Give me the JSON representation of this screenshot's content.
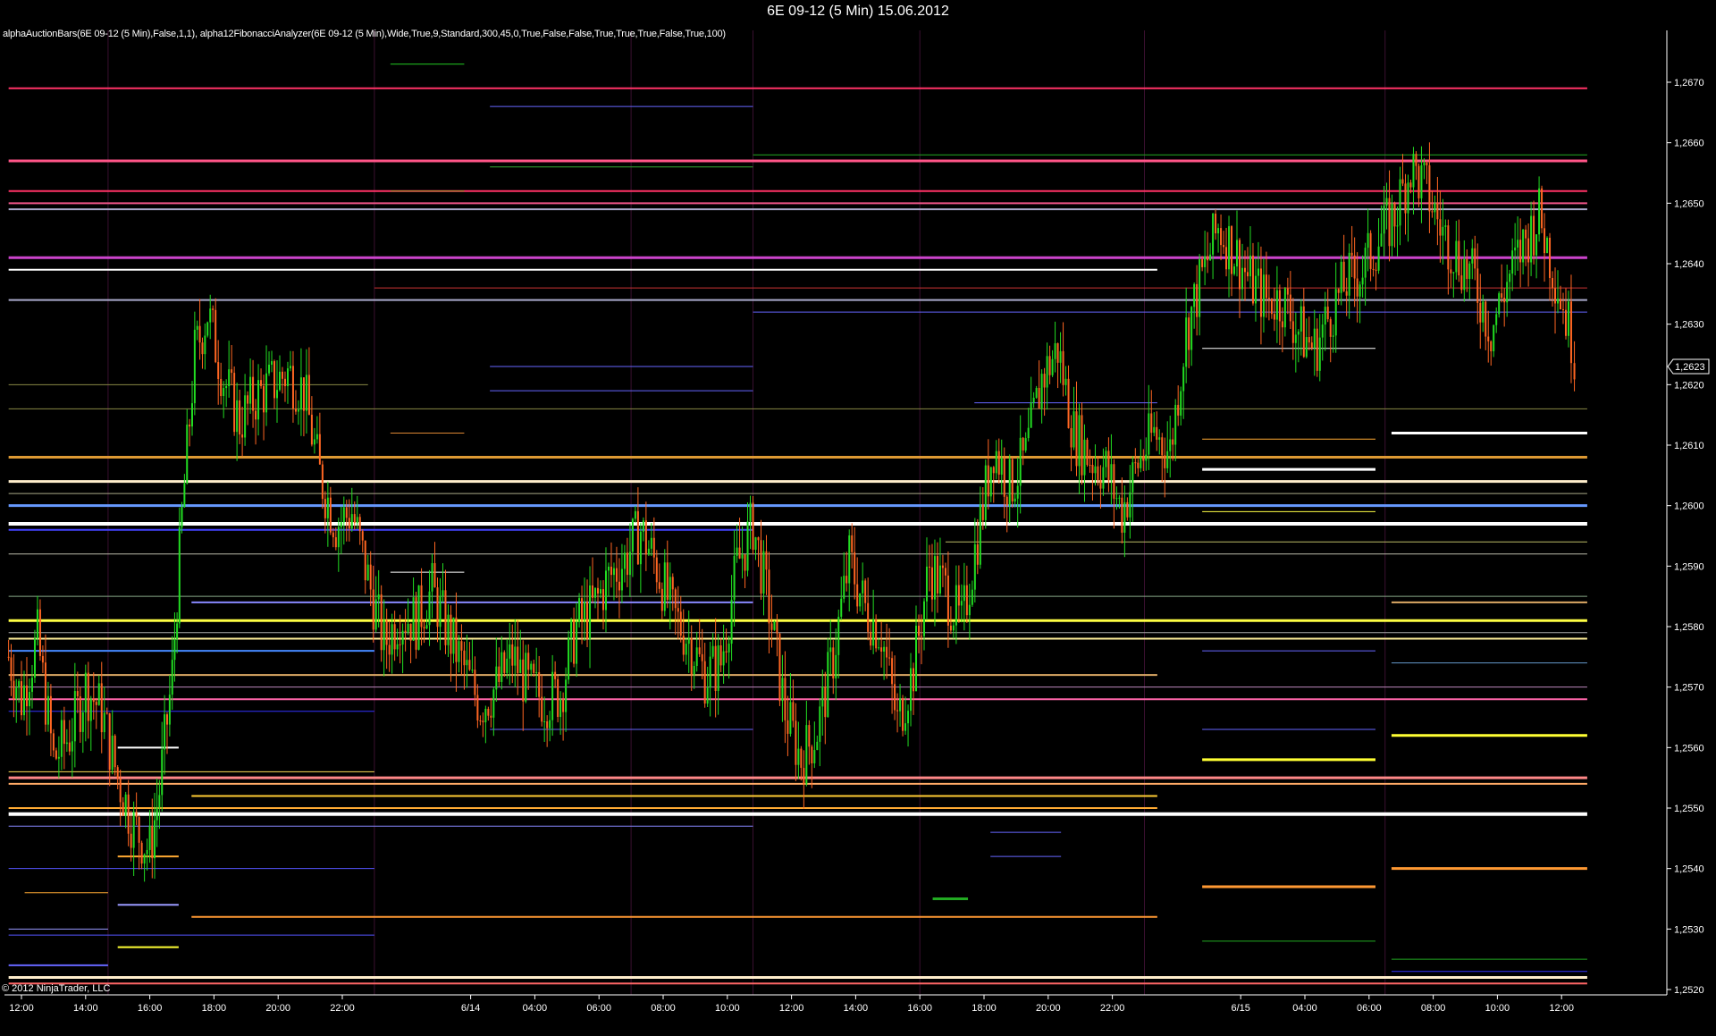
{
  "window": {
    "title": "6E 09-12 (5 Min)  15.06.2012"
  },
  "indicator_label": "alphaAuctionBars(6E 09-12 (5 Min),False,1,1), alpha12FibonacciAnalyzer(6E 09-12 (5 Min),Wide,True,9,Standard,300,45,0,True,False,False,True,True,True,False,True,100)",
  "copyright": "© 2012 NinjaTrader, LLC",
  "colors": {
    "background": "#000000",
    "axis": "#ffffff",
    "up_bar": "#22dd22",
    "down_bar": "#ff6622",
    "session_line": "#3a1030"
  },
  "chart_data": {
    "type": "candlestick",
    "instrument": "6E 09-12",
    "interval": "5 Min",
    "ylim": [
      1.25195,
      1.26775
    ],
    "y_ticks": [
      "1,2520",
      "1,2530",
      "1,2540",
      "1,2550",
      "1,2560",
      "1,2570",
      "1,2580",
      "1,2590",
      "1,2600",
      "1,2610",
      "1,2620",
      "1,2630",
      "1,2640",
      "1,2650",
      "1,2660",
      "1,2670"
    ],
    "y_tick_values": [
      1.252,
      1.253,
      1.254,
      1.255,
      1.256,
      1.257,
      1.258,
      1.259,
      1.26,
      1.261,
      1.262,
      1.263,
      1.264,
      1.265,
      1.266,
      1.267
    ],
    "last_price_label": "1,2623",
    "last_price": 1.2623,
    "x_ticks": [
      "12:00",
      "14:00",
      "16:00",
      "18:00",
      "20:00",
      "22:00",
      "6/14",
      "04:00",
      "06:00",
      "08:00",
      "10:00",
      "12:00",
      "14:00",
      "16:00",
      "18:00",
      "20:00",
      "22:00",
      "6/15",
      "04:00",
      "06:00",
      "08:00",
      "10:00",
      "12:00"
    ],
    "x_tick_hours": [
      12,
      14,
      16,
      18,
      20,
      22,
      26,
      28,
      30,
      32,
      34,
      36,
      38,
      40,
      42,
      44,
      46,
      50,
      52,
      54,
      56,
      58,
      60
    ],
    "session_starts_hours": [
      14.7,
      23,
      31,
      34.8,
      40,
      47,
      54.5
    ],
    "price_path": [
      [
        11.6,
        1.2575
      ],
      [
        12.0,
        1.2568
      ],
      [
        12.5,
        1.2578
      ],
      [
        13.0,
        1.2558
      ],
      [
        13.5,
        1.2562
      ],
      [
        14.0,
        1.257
      ],
      [
        14.5,
        1.2566
      ],
      [
        15.0,
        1.2555
      ],
      [
        15.5,
        1.2547
      ],
      [
        16.0,
        1.2543
      ],
      [
        16.3,
        1.2553
      ],
      [
        16.7,
        1.2572
      ],
      [
        17.0,
        1.2598
      ],
      [
        17.4,
        1.2625
      ],
      [
        17.8,
        1.2632
      ],
      [
        18.3,
        1.2621
      ],
      [
        18.8,
        1.2614
      ],
      [
        19.3,
        1.2618
      ],
      [
        19.8,
        1.262
      ],
      [
        20.3,
        1.2622
      ],
      [
        20.8,
        1.2619
      ],
      [
        21.3,
        1.2605
      ],
      [
        21.8,
        1.2597
      ],
      [
        22.3,
        1.2599
      ],
      [
        22.8,
        1.2588
      ],
      [
        23.3,
        1.2577
      ],
      [
        23.8,
        1.2582
      ],
      [
        24.3,
        1.2581
      ],
      [
        24.8,
        1.2586
      ],
      [
        25.3,
        1.2579
      ],
      [
        25.8,
        1.2573
      ],
      [
        26.3,
        1.2567
      ],
      [
        26.8,
        1.257
      ],
      [
        27.3,
        1.2575
      ],
      [
        27.8,
        1.257
      ],
      [
        28.3,
        1.2568
      ],
      [
        28.8,
        1.2569
      ],
      [
        29.3,
        1.258
      ],
      [
        29.8,
        1.2583
      ],
      [
        30.3,
        1.2588
      ],
      [
        30.8,
        1.2591
      ],
      [
        31.3,
        1.2596
      ],
      [
        31.8,
        1.259
      ],
      [
        32.3,
        1.2582
      ],
      [
        32.8,
        1.2578
      ],
      [
        33.3,
        1.2572
      ],
      [
        33.8,
        1.2574
      ],
      [
        34.3,
        1.259
      ],
      [
        34.8,
        1.2597
      ],
      [
        35.3,
        1.2583
      ],
      [
        35.8,
        1.2566
      ],
      [
        36.3,
        1.2558
      ],
      [
        36.8,
        1.2563
      ],
      [
        37.3,
        1.2575
      ],
      [
        37.8,
        1.2591
      ],
      [
        38.3,
        1.2583
      ],
      [
        38.8,
        1.2579
      ],
      [
        39.3,
        1.2564
      ],
      [
        39.8,
        1.2573
      ],
      [
        40.3,
        1.259
      ],
      [
        40.8,
        1.2586
      ],
      [
        41.3,
        1.258
      ],
      [
        41.8,
        1.2595
      ],
      [
        42.3,
        1.261
      ],
      [
        42.8,
        1.2603
      ],
      [
        43.3,
        1.2608
      ],
      [
        43.8,
        1.2621
      ],
      [
        44.3,
        1.2626
      ],
      [
        44.8,
        1.2612
      ],
      [
        45.3,
        1.2608
      ],
      [
        45.8,
        1.2606
      ],
      [
        46.3,
        1.2599
      ],
      [
        46.8,
        1.2607
      ],
      [
        47.3,
        1.2612
      ],
      [
        47.8,
        1.2609
      ],
      [
        48.3,
        1.2629
      ],
      [
        48.8,
        1.2638
      ],
      [
        49.3,
        1.2646
      ],
      [
        49.8,
        1.2642
      ],
      [
        50.3,
        1.2637
      ],
      [
        50.8,
        1.2634
      ],
      [
        51.3,
        1.2634
      ],
      [
        51.8,
        1.2629
      ],
      [
        52.3,
        1.2626
      ],
      [
        52.8,
        1.2632
      ],
      [
        53.3,
        1.2637
      ],
      [
        53.8,
        1.2639
      ],
      [
        54.3,
        1.2644
      ],
      [
        54.8,
        1.2648
      ],
      [
        55.3,
        1.2656
      ],
      [
        55.8,
        1.2652
      ],
      [
        56.3,
        1.2645
      ],
      [
        56.8,
        1.2641
      ],
      [
        57.3,
        1.2637
      ],
      [
        57.8,
        1.2629
      ],
      [
        58.3,
        1.2637
      ],
      [
        58.8,
        1.2643
      ],
      [
        59.3,
        1.2648
      ],
      [
        59.8,
        1.2638
      ],
      [
        60.3,
        1.2628
      ],
      [
        60.5,
        1.2623
      ]
    ],
    "levels": [
      {
        "price": 1.2669,
        "from": 11.6,
        "to": 60.8,
        "color": "#ff3366",
        "w": 2
      },
      {
        "price": 1.2657,
        "from": 11.6,
        "to": 60.8,
        "color": "#ff5588",
        "w": 3
      },
      {
        "price": 1.2658,
        "from": 34.8,
        "to": 60.8,
        "color": "#22aa22",
        "w": 1
      },
      {
        "price": 1.2652,
        "from": 11.6,
        "to": 60.8,
        "color": "#ff3366",
        "w": 2
      },
      {
        "price": 1.265,
        "from": 11.6,
        "to": 60.8,
        "color": "#ee5588",
        "w": 2
      },
      {
        "price": 1.2649,
        "from": 11.6,
        "to": 60.8,
        "color": "#aaaacc",
        "w": 2
      },
      {
        "price": 1.2641,
        "from": 11.6,
        "to": 60.8,
        "color": "#cc44cc",
        "w": 3
      },
      {
        "price": 1.2639,
        "from": 11.6,
        "to": 47.4,
        "color": "#ffffff",
        "w": 2
      },
      {
        "price": 1.2636,
        "from": 23,
        "to": 60.8,
        "color": "#cc3333",
        "w": 1
      },
      {
        "price": 1.2634,
        "from": 11.6,
        "to": 60.8,
        "color": "#aaaacc",
        "w": 2
      },
      {
        "price": 1.2632,
        "from": 34.8,
        "to": 60.8,
        "color": "#6666ff",
        "w": 1
      },
      {
        "price": 1.2626,
        "from": 48.8,
        "to": 54.2,
        "color": "#ffffff",
        "w": 1
      },
      {
        "price": 1.262,
        "from": 11.6,
        "to": 22.8,
        "color": "#888844",
        "w": 1
      },
      {
        "price": 1.2616,
        "from": 11.6,
        "to": 60.8,
        "color": "#888844",
        "w": 1
      },
      {
        "price": 1.2612,
        "from": 54.7,
        "to": 60.8,
        "color": "#ffffff",
        "w": 3
      },
      {
        "price": 1.2608,
        "from": 11.6,
        "to": 60.8,
        "color": "#dd9933",
        "w": 3
      },
      {
        "price": 1.2606,
        "from": 48.8,
        "to": 54.2,
        "color": "#ffffff",
        "w": 3
      },
      {
        "price": 1.2604,
        "from": 11.6,
        "to": 60.8,
        "color": "#ffeecc",
        "w": 3
      },
      {
        "price": 1.2602,
        "from": 11.6,
        "to": 60.8,
        "color": "#aaaa88",
        "w": 1
      },
      {
        "price": 1.26,
        "from": 11.6,
        "to": 60.8,
        "color": "#6699ff",
        "w": 3
      },
      {
        "price": 1.2597,
        "from": 11.6,
        "to": 60.8,
        "color": "#ffffff",
        "w": 4
      },
      {
        "price": 1.2596,
        "from": 11.6,
        "to": 34.8,
        "color": "#4444ff",
        "w": 2
      },
      {
        "price": 1.2594,
        "from": 40.8,
        "to": 60.8,
        "color": "#bbbb66",
        "w": 1
      },
      {
        "price": 1.2592,
        "from": 11.6,
        "to": 60.8,
        "color": "#bbbbaa",
        "w": 1
      },
      {
        "price": 1.2585,
        "from": 11.6,
        "to": 60.8,
        "color": "#88aa88",
        "w": 1
      },
      {
        "price": 1.2584,
        "from": 54.7,
        "to": 60.8,
        "color": "#ddaa66",
        "w": 2
      },
      {
        "price": 1.2581,
        "from": 11.6,
        "to": 60.8,
        "color": "#ffff44",
        "w": 3
      },
      {
        "price": 1.2579,
        "from": 11.6,
        "to": 60.8,
        "color": "#aaaaaa",
        "w": 1
      },
      {
        "price": 1.2578,
        "from": 11.6,
        "to": 60.8,
        "color": "#ffee99",
        "w": 2
      },
      {
        "price": 1.2576,
        "from": 11.6,
        "to": 23,
        "color": "#4488ff",
        "w": 2
      },
      {
        "price": 1.2574,
        "from": 54.7,
        "to": 60.8,
        "color": "#6699cc",
        "w": 1
      },
      {
        "price": 1.2572,
        "from": 11.6,
        "to": 47.4,
        "color": "#ddaa66",
        "w": 2
      },
      {
        "price": 1.257,
        "from": 11.6,
        "to": 60.8,
        "color": "#bb88bb",
        "w": 1
      },
      {
        "price": 1.2568,
        "from": 11.6,
        "to": 60.8,
        "color": "#ff66aa",
        "w": 2
      },
      {
        "price": 1.2566,
        "from": 11.6,
        "to": 23,
        "color": "#3333ff",
        "w": 1
      },
      {
        "price": 1.2562,
        "from": 54.7,
        "to": 60.8,
        "color": "#ffff33",
        "w": 3
      },
      {
        "price": 1.2558,
        "from": 48.8,
        "to": 54.2,
        "color": "#ffff33",
        "w": 3
      },
      {
        "price": 1.2555,
        "from": 11.6,
        "to": 60.8,
        "color": "#ff8888",
        "w": 3
      },
      {
        "price": 1.2554,
        "from": 11.6,
        "to": 60.8,
        "color": "#ffaa66",
        "w": 2
      },
      {
        "price": 1.2552,
        "from": 17.3,
        "to": 47.4,
        "color": "#ffcc33",
        "w": 2
      },
      {
        "price": 1.255,
        "from": 11.6,
        "to": 47.4,
        "color": "#ffaa33",
        "w": 2
      },
      {
        "price": 1.2549,
        "from": 11.6,
        "to": 60.8,
        "color": "#ffffff",
        "w": 4
      },
      {
        "price": 1.2547,
        "from": 11.6,
        "to": 34.8,
        "color": "#8888ff",
        "w": 1
      },
      {
        "price": 1.254,
        "from": 54.7,
        "to": 60.8,
        "color": "#ff9933",
        "w": 3
      },
      {
        "price": 1.254,
        "from": 11.6,
        "to": 23,
        "color": "#5555ff",
        "w": 1
      },
      {
        "price": 1.2537,
        "from": 48.8,
        "to": 54.2,
        "color": "#ff9933",
        "w": 3
      },
      {
        "price": 1.2532,
        "from": 17.3,
        "to": 47.4,
        "color": "#ff9933",
        "w": 2
      },
      {
        "price": 1.2529,
        "from": 11.6,
        "to": 23,
        "color": "#5555ff",
        "w": 1
      },
      {
        "price": 1.2525,
        "from": 54.7,
        "to": 60.8,
        "color": "#22aa22",
        "w": 1
      },
      {
        "price": 1.2523,
        "from": 54.7,
        "to": 60.8,
        "color": "#3333ff",
        "w": 1
      },
      {
        "price": 1.2522,
        "from": 11.6,
        "to": 60.8,
        "color": "#ffeecc",
        "w": 3
      },
      {
        "price": 1.2521,
        "from": 11.6,
        "to": 60.8,
        "color": "#ff6666",
        "w": 2
      },
      {
        "price": 1.2666,
        "from": 26.6,
        "to": 34.8,
        "color": "#6666ff",
        "w": 1
      },
      {
        "price": 1.2673,
        "from": 23.5,
        "to": 25.8,
        "color": "#22cc22",
        "w": 1
      },
      {
        "price": 1.2656,
        "from": 26.6,
        "to": 34.8,
        "color": "#33aa33",
        "w": 1
      },
      {
        "price": 1.2652,
        "from": 23.5,
        "to": 25.8,
        "color": "#999922",
        "w": 1
      },
      {
        "price": 1.2623,
        "from": 26.6,
        "to": 34.8,
        "color": "#6666ff",
        "w": 1
      },
      {
        "price": 1.2619,
        "from": 26.6,
        "to": 34.8,
        "color": "#6666ff",
        "w": 1
      },
      {
        "price": 1.2612,
        "from": 23.5,
        "to": 25.8,
        "color": "#dd8833",
        "w": 1
      },
      {
        "price": 1.2589,
        "from": 23.5,
        "to": 25.8,
        "color": "#ffffff",
        "w": 1
      },
      {
        "price": 1.2563,
        "from": 26.6,
        "to": 34.8,
        "color": "#6666ff",
        "w": 1
      },
      {
        "price": 1.2611,
        "from": 48.8,
        "to": 54.2,
        "color": "#ffaa33",
        "w": 1
      },
      {
        "price": 1.2599,
        "from": 48.8,
        "to": 54.2,
        "color": "#ffff44",
        "w": 1
      },
      {
        "price": 1.2576,
        "from": 48.8,
        "to": 54.2,
        "color": "#6666ff",
        "w": 1
      },
      {
        "price": 1.2563,
        "from": 48.8,
        "to": 54.2,
        "color": "#6666ff",
        "w": 1
      },
      {
        "price": 1.2528,
        "from": 48.8,
        "to": 54.2,
        "color": "#22aa22",
        "w": 1
      },
      {
        "price": 1.2556,
        "from": 11.6,
        "to": 23,
        "color": "#ffdd55",
        "w": 1
      },
      {
        "price": 1.2536,
        "from": 12.1,
        "to": 14.7,
        "color": "#ffaa33",
        "w": 1
      },
      {
        "price": 1.253,
        "from": 11.6,
        "to": 14.7,
        "color": "#9999ff",
        "w": 1
      },
      {
        "price": 1.2524,
        "from": 11.6,
        "to": 14.7,
        "color": "#6666ff",
        "w": 2
      },
      {
        "price": 1.256,
        "from": 15.0,
        "to": 16.9,
        "color": "#ffffff",
        "w": 2
      },
      {
        "price": 1.2542,
        "from": 15.0,
        "to": 16.9,
        "color": "#ffaa33",
        "w": 2
      },
      {
        "price": 1.2534,
        "from": 15.0,
        "to": 16.9,
        "color": "#9999ff",
        "w": 2
      },
      {
        "price": 1.2527,
        "from": 15.0,
        "to": 16.9,
        "color": "#ffff33",
        "w": 2
      },
      {
        "price": 1.2584,
        "from": 17.3,
        "to": 34.8,
        "color": "#8888ff",
        "w": 2
      },
      {
        "price": 1.2597,
        "from": 17.3,
        "to": 47.4,
        "color": "#ffffff",
        "w": 2
      },
      {
        "price": 1.2617,
        "from": 41.7,
        "to": 47.4,
        "color": "#6666ff",
        "w": 1
      },
      {
        "price": 1.2535,
        "from": 40.4,
        "to": 41.5,
        "color": "#22aa22",
        "w": 3
      },
      {
        "price": 1.2546,
        "from": 42.2,
        "to": 44.4,
        "color": "#6666ff",
        "w": 1
      },
      {
        "price": 1.2542,
        "from": 42.2,
        "to": 44.4,
        "color": "#6666ff",
        "w": 1
      }
    ]
  }
}
